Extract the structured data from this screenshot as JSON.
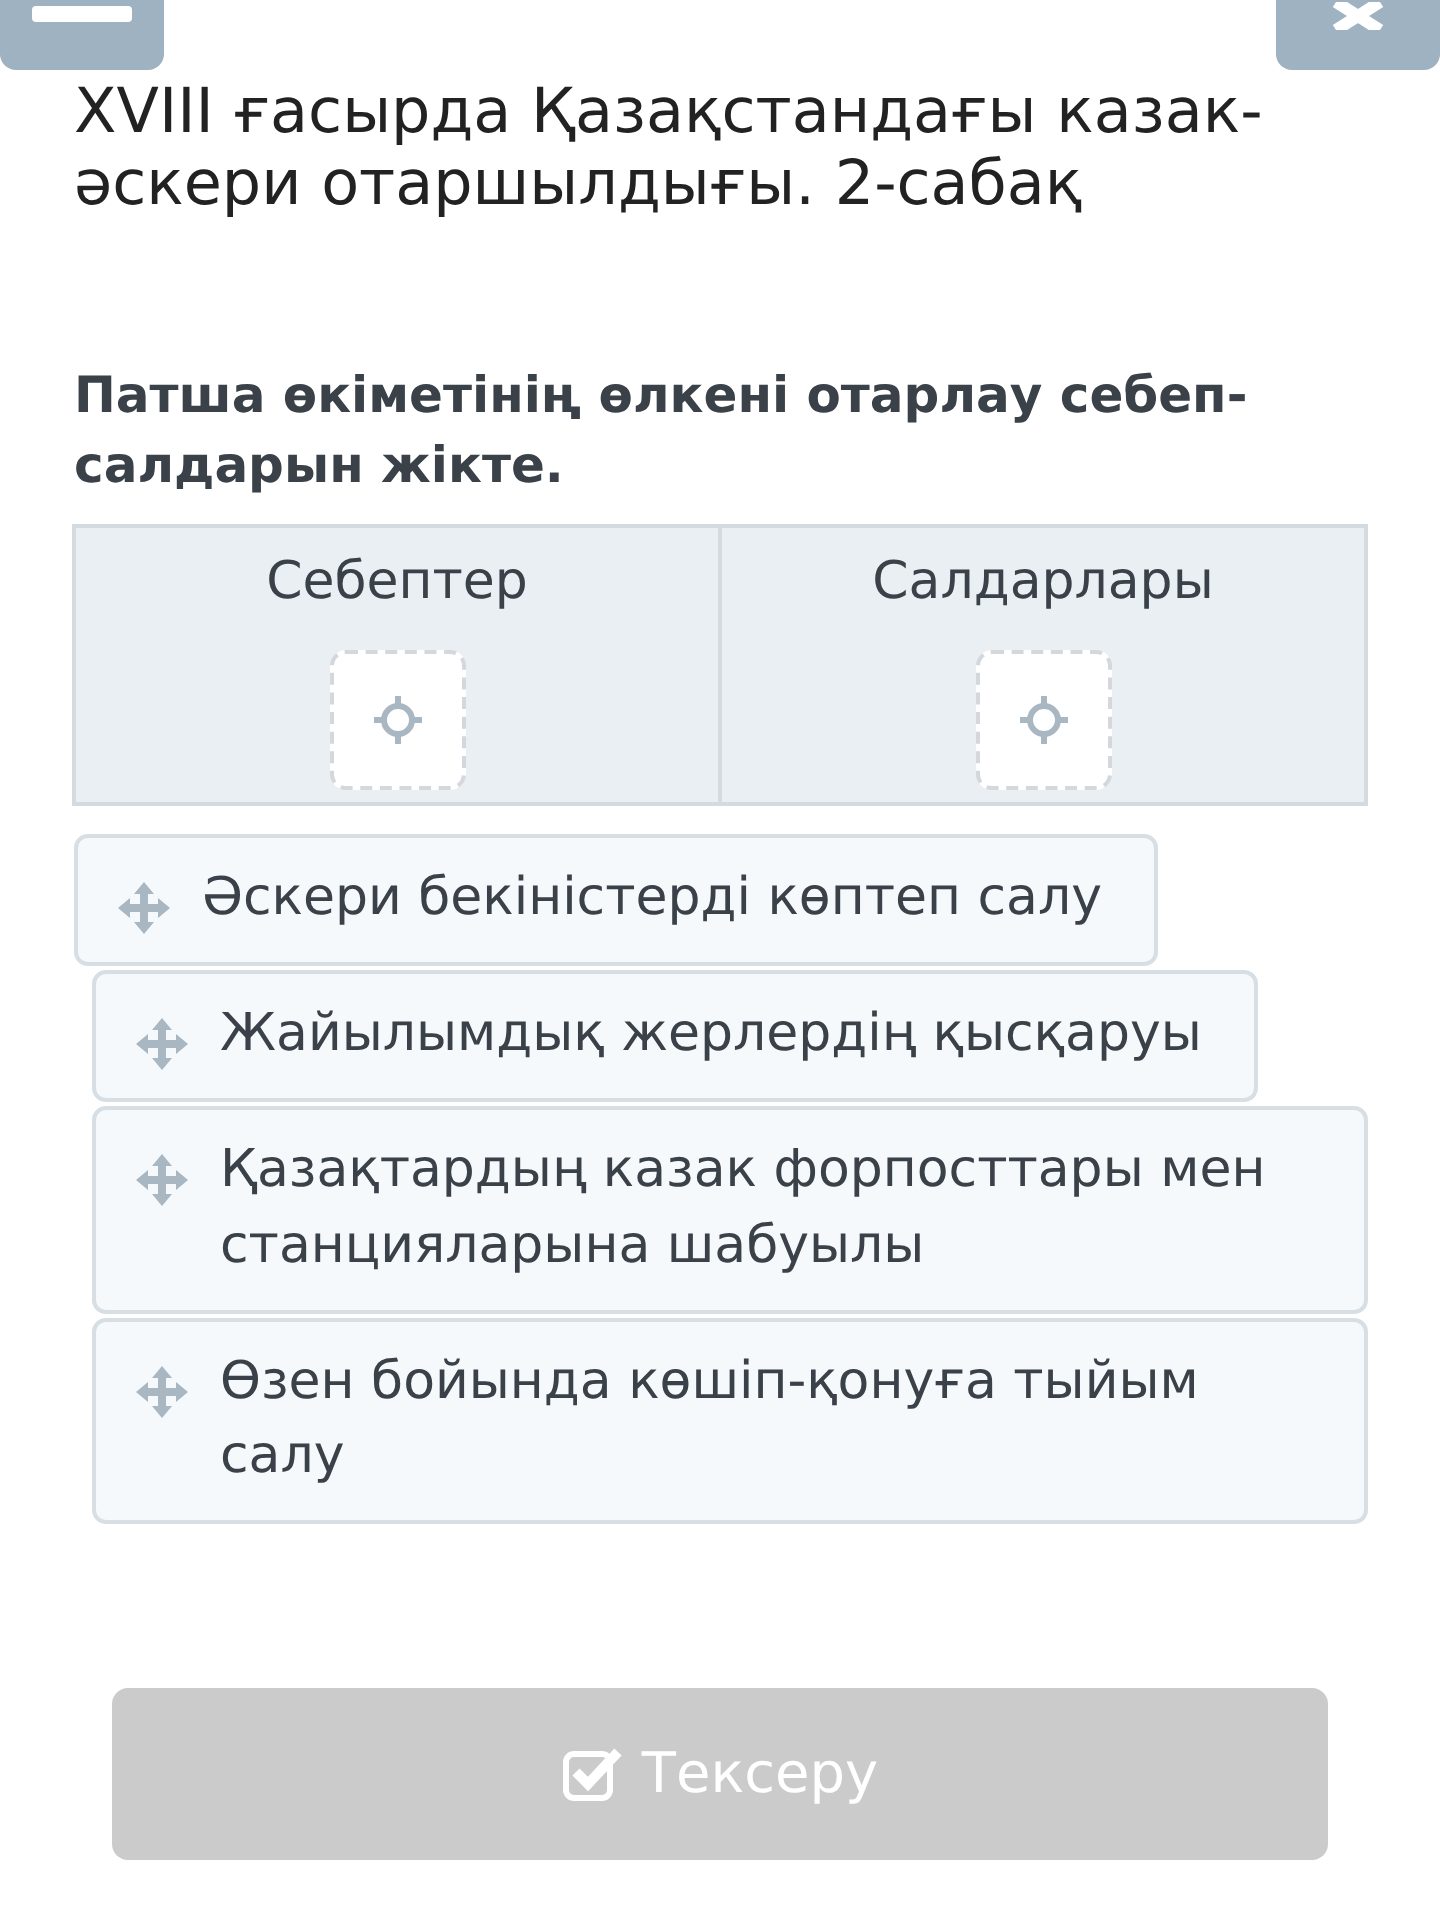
{
  "title": "XVIII ғасырда Қазақстандағы казак-әскери отаршылдығы. 2-сабақ",
  "question": "Патша өкіметінің өлкені отарлау себеп-салдарын жікте.",
  "targets": [
    {
      "label": "Себептер"
    },
    {
      "label": "Салдарлары"
    }
  ],
  "items": [
    {
      "text": "Әскери бекіністерді көптеп салу"
    },
    {
      "text": "Жайылымдық жерлердің қысқаруы"
    },
    {
      "text": "Қазақтардың казак форпосттары мен станцияларына шабуылы"
    },
    {
      "text": "Өзен бойында көшіп-қонуға тыйым салу"
    }
  ],
  "check_button": {
    "label": "Тексеру",
    "disabled": true
  }
}
